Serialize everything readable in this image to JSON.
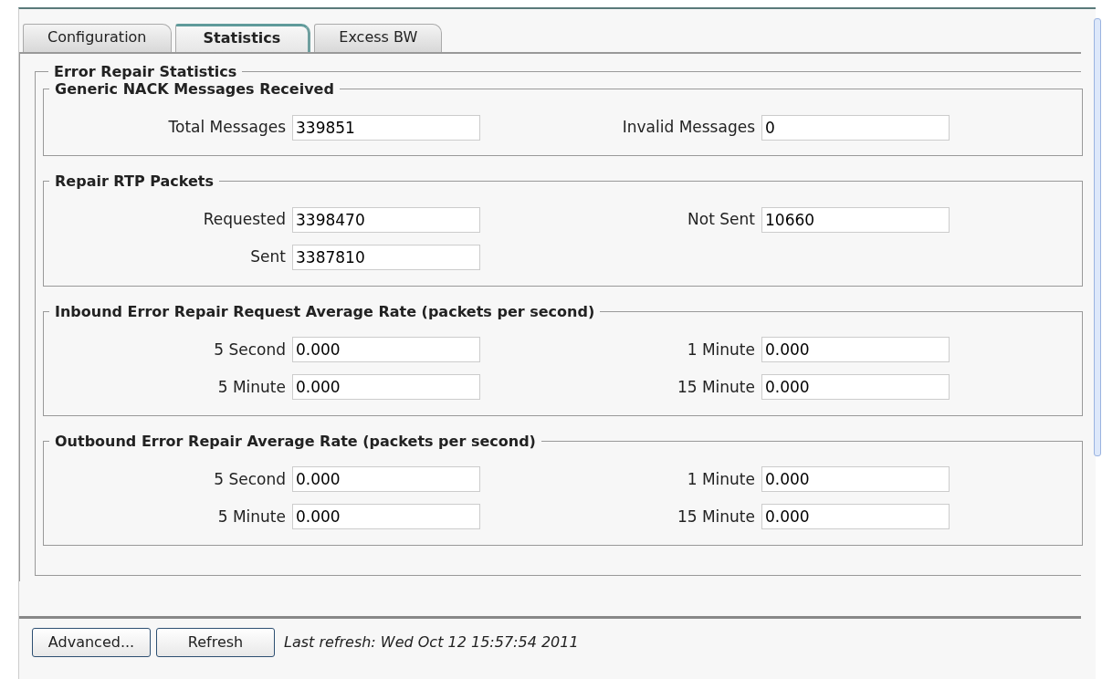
{
  "tabs": [
    {
      "label": "Configuration",
      "selected": false
    },
    {
      "label": "Statistics",
      "selected": true
    },
    {
      "label": "Excess BW",
      "selected": false
    }
  ],
  "panel": {
    "title": "Error Repair Statistics",
    "sections": [
      {
        "title": "Generic NACK Messages Received",
        "rows": [
          [
            {
              "label": "Total Messages",
              "value": "339851"
            },
            {
              "label": "Invalid Messages",
              "value": "0"
            }
          ]
        ]
      },
      {
        "title": "Repair RTP Packets",
        "rows": [
          [
            {
              "label": "Requested",
              "value": "3398470"
            },
            {
              "label": "Not Sent",
              "value": "10660"
            }
          ],
          [
            {
              "label": "Sent",
              "value": "3387810"
            }
          ]
        ]
      },
      {
        "title": "Inbound Error Repair Request Average Rate (packets per second)",
        "rows": [
          [
            {
              "label": "5 Second",
              "value": "0.000"
            },
            {
              "label": "1 Minute",
              "value": "0.000"
            }
          ],
          [
            {
              "label": "5 Minute",
              "value": "0.000"
            },
            {
              "label": "15 Minute",
              "value": "0.000"
            }
          ]
        ]
      },
      {
        "title": "Outbound Error Repair Average Rate (packets per second)",
        "rows": [
          [
            {
              "label": "5 Second",
              "value": "0.000"
            },
            {
              "label": "1 Minute",
              "value": "0.000"
            }
          ],
          [
            {
              "label": "5 Minute",
              "value": "0.000"
            },
            {
              "label": "15 Minute",
              "value": "0.000"
            }
          ]
        ]
      }
    ]
  },
  "buttons": [
    "Advanced...",
    "Refresh"
  ],
  "last_refresh": "Last refresh: Wed Oct 12 15:57:54 2011"
}
